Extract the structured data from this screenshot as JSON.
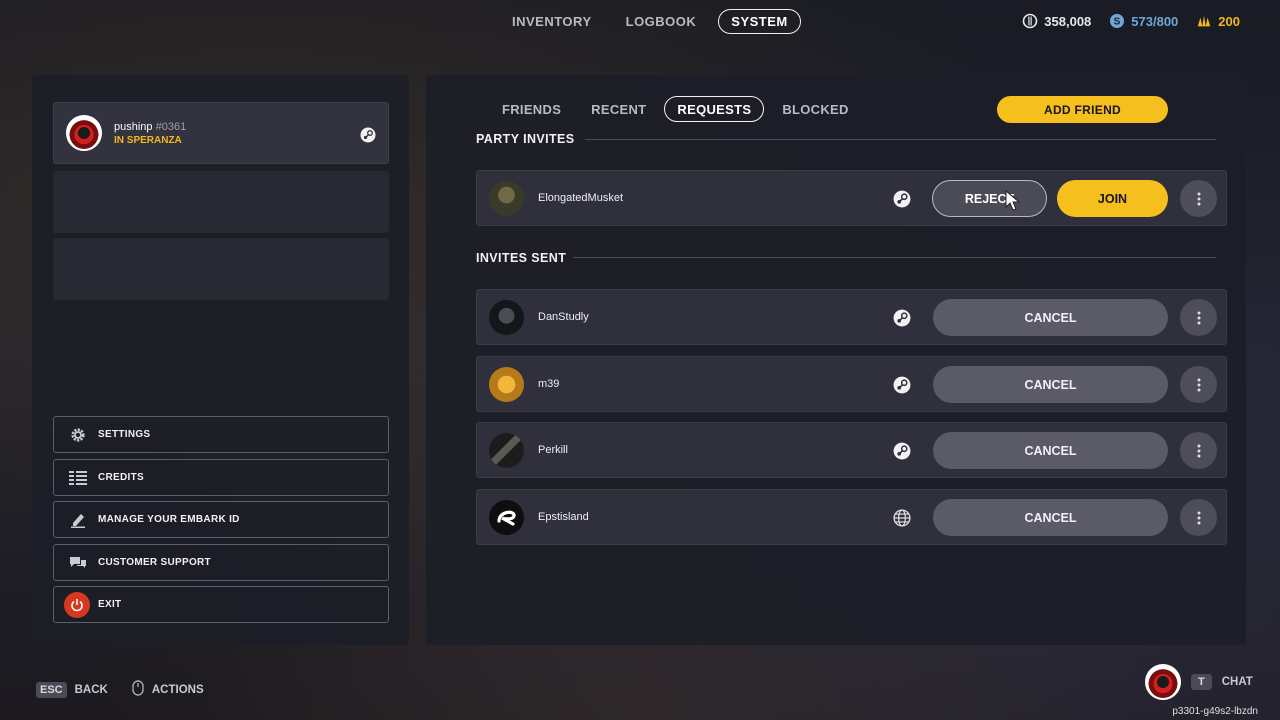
{
  "top_nav": {
    "tabs": [
      {
        "label": "INVENTORY",
        "active": false
      },
      {
        "label": "LOGBOOK",
        "active": false
      },
      {
        "label": "SYSTEM",
        "active": true
      }
    ]
  },
  "currencies": [
    {
      "icon": "coin-icon",
      "value": "358,008",
      "color": "#e8e8ee"
    },
    {
      "icon": "ticket-icon",
      "value": "573/800",
      "color": "#6ea7d6"
    },
    {
      "icon": "bullion-icon",
      "value": "200",
      "color": "#f2b81c"
    }
  ],
  "profile": {
    "name": "pushinp",
    "tag": "#0361",
    "status": "IN SPERANZA",
    "platform_icon": "steam-icon"
  },
  "menu": {
    "settings": "SETTINGS",
    "credits": "CREDITS",
    "manage_id": "MANAGE YOUR EMBARK ID",
    "support": "CUSTOMER SUPPORT",
    "exit": "EXIT"
  },
  "friends_tabs": [
    {
      "label": "FRIENDS",
      "active": false
    },
    {
      "label": "RECENT",
      "active": false
    },
    {
      "label": "REQUESTS",
      "active": true
    },
    {
      "label": "BLOCKED",
      "active": false
    }
  ],
  "add_friend_label": "ADD FRIEND",
  "party_invites": {
    "title": "PARTY INVITES",
    "items": [
      {
        "name": "ElongatedMusket",
        "platform": "steam-icon",
        "reject_label": "REJECT",
        "join_label": "JOIN"
      }
    ]
  },
  "invites_sent": {
    "title": "INVITES SENT",
    "items": [
      {
        "name": "DanStudly",
        "platform": "steam-icon",
        "cancel_label": "CANCEL"
      },
      {
        "name": "m39",
        "platform": "steam-icon",
        "cancel_label": "CANCEL"
      },
      {
        "name": "Perkill",
        "platform": "steam-icon",
        "cancel_label": "CANCEL"
      },
      {
        "name": "Epstisland",
        "platform": "globe-icon",
        "cancel_label": "CANCEL"
      }
    ]
  },
  "footer": {
    "esc_key": "ESC",
    "back_label": "BACK",
    "actions_label": "ACTIONS",
    "chat_key": "T",
    "chat_label": "CHAT",
    "session_id": "p3301-g49s2-lbzdn"
  },
  "colors": {
    "accent_yellow": "#f5c01d",
    "exit_red": "#d6381f"
  }
}
